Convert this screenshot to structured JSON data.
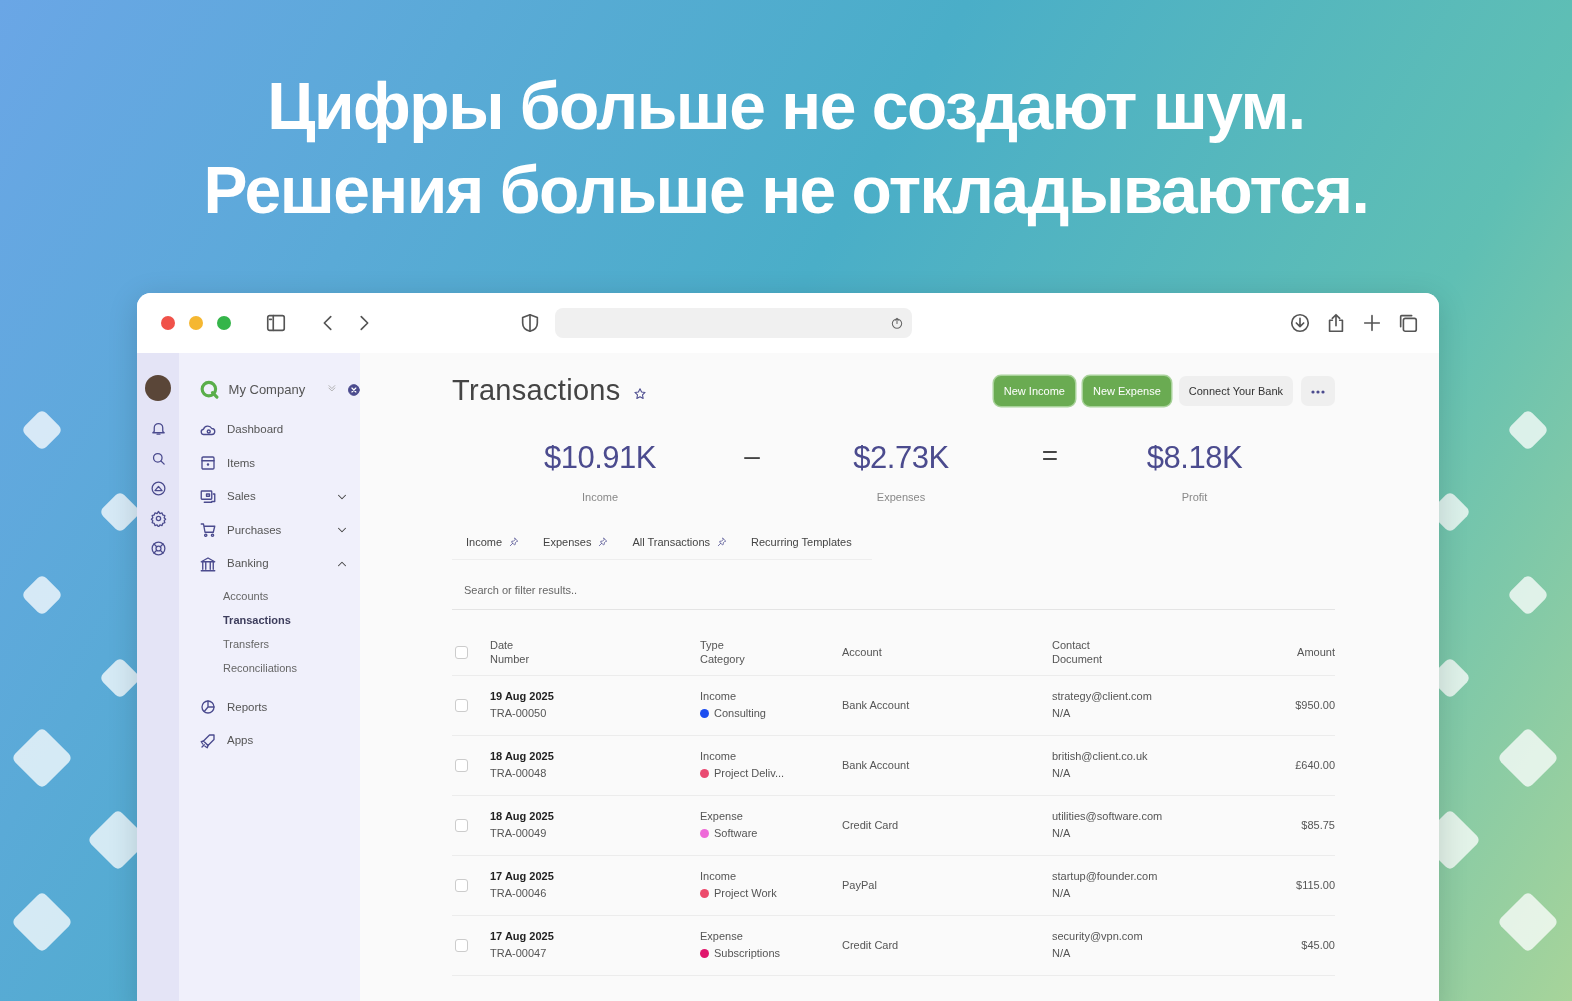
{
  "headline": [
    "Цифры больше не создают шум.",
    "Решения больше не откладываются."
  ],
  "sidebar": {
    "company": "My Company",
    "items": [
      {
        "label": "Dashboard"
      },
      {
        "label": "Items"
      },
      {
        "label": "Sales",
        "expanded": false
      },
      {
        "label": "Purchases",
        "expanded": false
      },
      {
        "label": "Banking",
        "expanded": true,
        "children": [
          {
            "label": "Accounts",
            "selected": false
          },
          {
            "label": "Transactions",
            "selected": true
          },
          {
            "label": "Transfers",
            "selected": false
          },
          {
            "label": "Reconciliations",
            "selected": false
          }
        ]
      },
      {
        "label": "Reports"
      },
      {
        "label": "Apps"
      }
    ]
  },
  "page": {
    "title": "Transactions",
    "buttons": [
      {
        "label": "New Income",
        "kind": "primary"
      },
      {
        "label": "New Expense",
        "kind": "primary"
      },
      {
        "label": "Connect Your Bank",
        "kind": "secondary"
      }
    ],
    "summary": [
      {
        "value": "$10.91K",
        "label": "Income"
      },
      {
        "operator": "–"
      },
      {
        "value": "$2.73K",
        "label": "Expenses"
      },
      {
        "operator": "="
      },
      {
        "value": "$8.18K",
        "label": "Profit"
      }
    ],
    "tabs": [
      {
        "label": "Income",
        "pinned": true
      },
      {
        "label": "Expenses",
        "pinned": true
      },
      {
        "label": "All Transactions",
        "pinned": true
      },
      {
        "label": "Recurring Templates",
        "pinned": false
      }
    ],
    "search": {
      "placeholder": "Search or filter results.."
    },
    "table": {
      "columns": [
        {
          "title": "Date",
          "subtitle": "Number"
        },
        {
          "title": "Type",
          "subtitle": "Category"
        },
        {
          "title": "Account"
        },
        {
          "title": "Contact",
          "subtitle": "Document"
        },
        {
          "title": "Amount"
        }
      ],
      "header_checked": false,
      "rows": [
        {
          "checked": false,
          "date": "19 Aug 2025",
          "number": "TRA-00050",
          "type": "Income",
          "category": "Consulting",
          "color": "#1d4ef0",
          "account": "Bank Account",
          "contact": "strategy@client.com",
          "document": "N/A",
          "amount": "$950.00"
        },
        {
          "checked": false,
          "date": "18 Aug 2025",
          "number": "TRA-00048",
          "type": "Income",
          "category": "Project Deliv...",
          "color": "#e94a72",
          "account": "Bank Account",
          "contact": "british@client.co.uk",
          "document": "N/A",
          "amount": "£640.00"
        },
        {
          "checked": false,
          "date": "18 Aug 2025",
          "number": "TRA-00049",
          "type": "Expense",
          "category": "Software",
          "color": "#ee6ad8",
          "account": "Credit Card",
          "contact": "utilities@software.com",
          "document": "N/A",
          "amount": "$85.75"
        },
        {
          "checked": false,
          "date": "17 Aug 2025",
          "number": "TRA-00046",
          "type": "Income",
          "category": "Project Work",
          "color": "#ec4a6c",
          "account": "PayPal",
          "contact": "startup@founder.com",
          "document": "N/A",
          "amount": "$115.00"
        },
        {
          "checked": false,
          "date": "17 Aug 2025",
          "number": "TRA-00047",
          "type": "Expense",
          "category": "Subscriptions",
          "color": "#e0166c",
          "account": "Credit Card",
          "contact": "security@vpn.com",
          "document": "N/A",
          "amount": "$45.00"
        }
      ]
    }
  }
}
